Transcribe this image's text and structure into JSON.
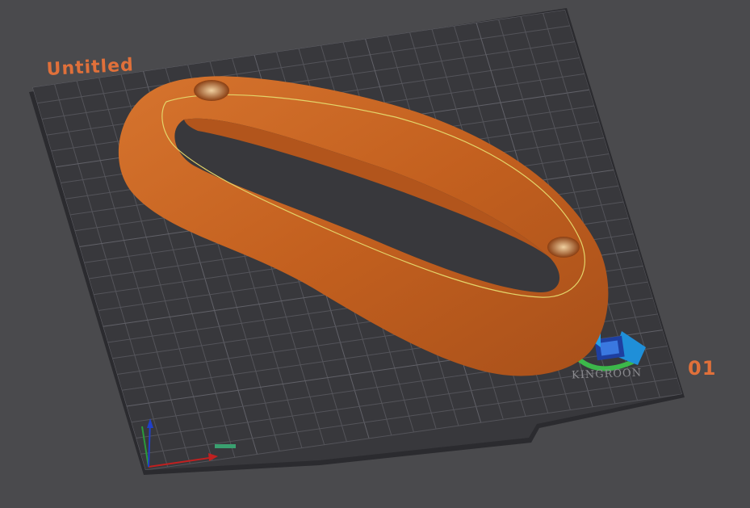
{
  "viewport": {
    "plate_name": "Untitled",
    "plate_index": "01",
    "bed_brand": "KINGROON",
    "colors": {
      "background": "#4a4a4d",
      "bed": "#38383c",
      "grid": "#55555a",
      "model": "#c4611f",
      "model_highlight": "#d8782e",
      "seam": "#e8e070",
      "label": "#e0703a"
    },
    "icons": [
      "axes-gizmo-icon",
      "kingroon-logo-icon"
    ]
  }
}
